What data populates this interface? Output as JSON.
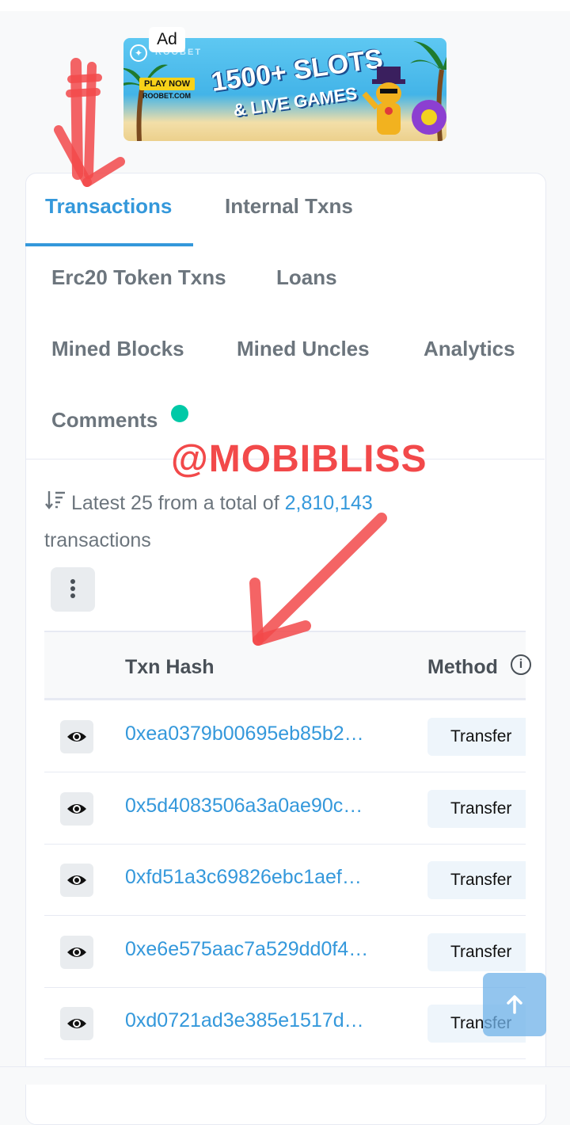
{
  "ad": {
    "badge": "Ad",
    "play_now": "PLAY NOW",
    "site": "ROOBET.COM",
    "brand": "ROOBET",
    "headline": "1500+ SLOTS",
    "subheadline": "& LIVE GAMES"
  },
  "tabs": [
    {
      "label": "Transactions",
      "active": true
    },
    {
      "label": "Internal Txns"
    },
    {
      "label": "Erc20 Token Txns"
    },
    {
      "label": "Loans"
    },
    {
      "label": "Mined Blocks"
    },
    {
      "label": "Mined Uncles"
    },
    {
      "label": "Analytics"
    },
    {
      "label": "Comments"
    }
  ],
  "watermark": "@MOBIBLISS",
  "summary": {
    "prefix": "Latest 25 from a total of",
    "count": "2,810,143",
    "suffix": "transactions"
  },
  "table": {
    "headers": {
      "hash": "Txn Hash",
      "method": "Method"
    },
    "rows": [
      {
        "hash": "0xea0379b00695eb85b2…",
        "method": "Transfer"
      },
      {
        "hash": "0x5d4083506a3a0ae90c…",
        "method": "Transfer"
      },
      {
        "hash": "0xfd51a3c69826ebc1aef…",
        "method": "Transfer"
      },
      {
        "hash": "0xe6e575aac7a529dd0f4…",
        "method": "Transfer"
      },
      {
        "hash": "0xd0721ad3e385e1517d…",
        "method": "Transfer"
      }
    ]
  },
  "colors": {
    "accent": "#3498db",
    "annotation": "#f2494a",
    "status_dot": "#00c9a7"
  },
  "icons": [
    "sort-icon",
    "more-vertical-icon",
    "info-icon",
    "eye-icon",
    "arrow-up-icon"
  ]
}
